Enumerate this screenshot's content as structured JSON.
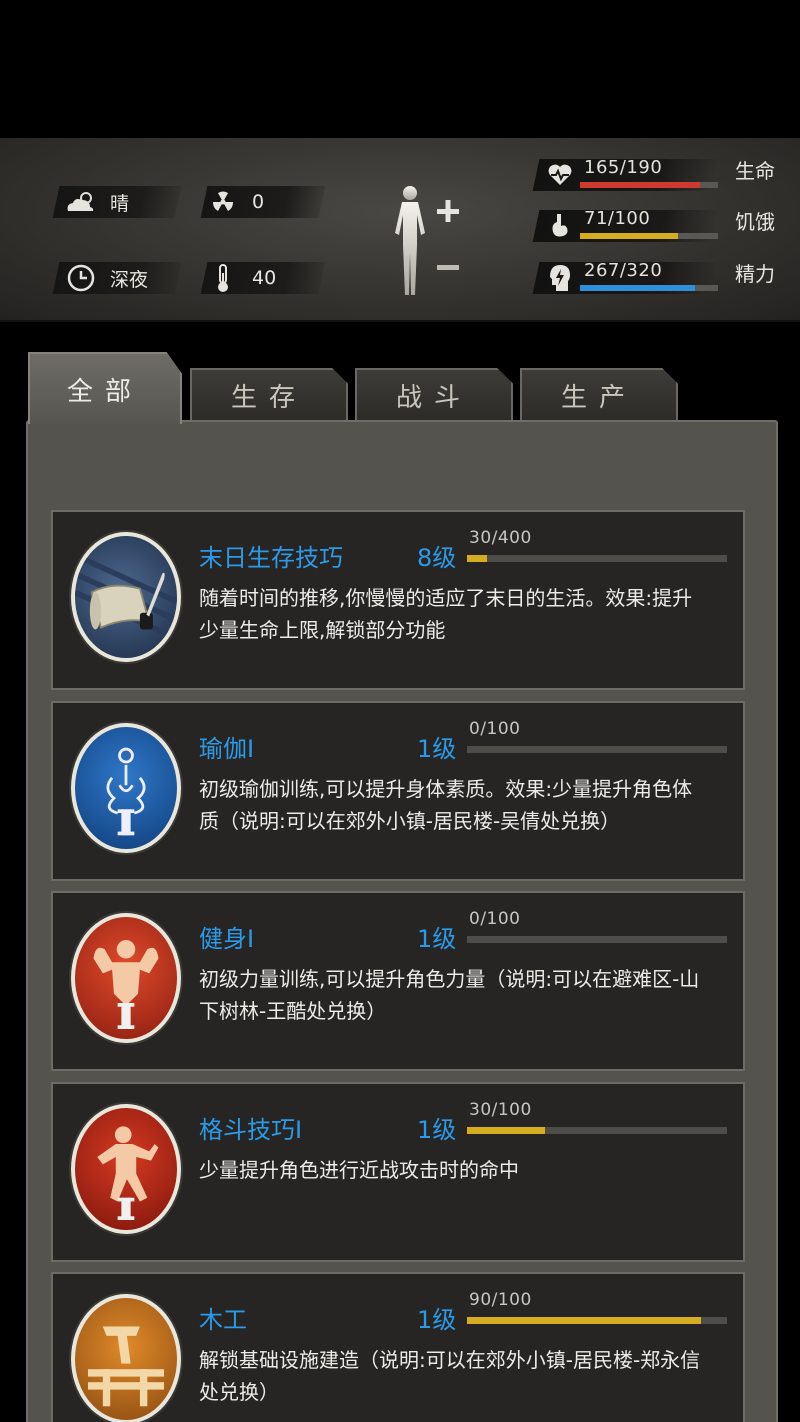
{
  "hud": {
    "weather": "晴",
    "radiation": "0",
    "time_of_day": "深夜",
    "temperature": "40",
    "icons": {
      "weather": "cloud-sun-icon",
      "radiation": "radiation-icon",
      "clock": "clock-icon",
      "thermometer": "thermometer-icon",
      "body": "body-figure-icon"
    },
    "stats": [
      {
        "label": "生命",
        "value": "165/190",
        "fraction": 0.868,
        "color": "#cf3a30",
        "icon": "heart-pulse-icon"
      },
      {
        "label": "饥饿",
        "value": "71/100",
        "fraction": 0.71,
        "color": "#d4ad21",
        "icon": "stomach-icon"
      },
      {
        "label": "精力",
        "value": "267/320",
        "fraction": 0.834,
        "color": "#2f8fd8",
        "icon": "energy-head-icon"
      }
    ]
  },
  "tabs": [
    {
      "label": "全部",
      "active": true
    },
    {
      "label": "生存",
      "active": false
    },
    {
      "label": "战斗",
      "active": false
    },
    {
      "label": "生产",
      "active": false
    }
  ],
  "skills": [
    {
      "title": "末日生存技巧",
      "level": "8级",
      "progress_text": "30/400",
      "progress": 0.075,
      "desc": "随着时间的推移,你慢慢的适应了末日的生活。效果:提升少量生命上限,解锁部分功能",
      "icon": "scroll-quill-icon"
    },
    {
      "title": "瑜伽Ⅰ",
      "level": "1级",
      "progress_text": "0/100",
      "progress": 0.0,
      "desc": "初级瑜伽训练,可以提升身体素质。效果:少量提升角色体质（说明:可以在郊外小镇-居民楼-吴倩处兑换）",
      "icon": "meditation-icon"
    },
    {
      "title": "健身Ⅰ",
      "level": "1级",
      "progress_text": "0/100",
      "progress": 0.0,
      "desc": "初级力量训练,可以提升角色力量（说明:可以在避难区-山下树林-王酷处兑换）",
      "icon": "muscle-icon"
    },
    {
      "title": "格斗技巧Ⅰ",
      "level": "1级",
      "progress_text": "30/100",
      "progress": 0.3,
      "desc": "少量提升角色进行近战攻击时的命中",
      "icon": "fighter-icon"
    },
    {
      "title": "木工",
      "level": "1级",
      "progress_text": "90/100",
      "progress": 0.9,
      "desc": "解锁基础设施建造（说明:可以在郊外小镇-居民楼-郑永信处兑换）",
      "icon": "carpentry-icon"
    }
  ]
}
